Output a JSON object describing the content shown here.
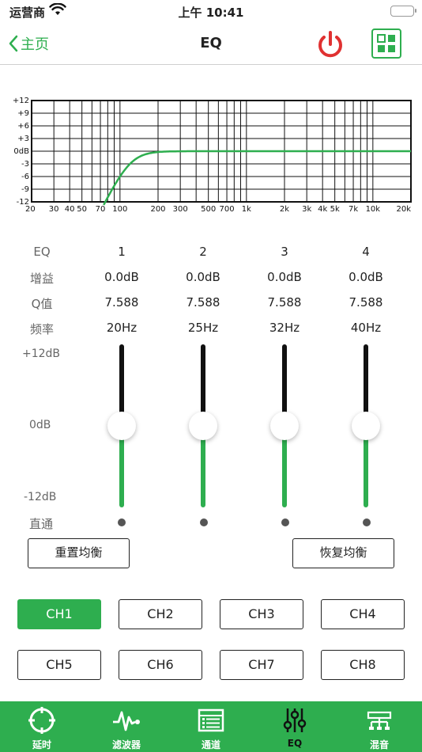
{
  "status": {
    "carrier": "运营商",
    "time": "上午 10:41"
  },
  "nav": {
    "back_label": "主页",
    "title": "EQ"
  },
  "graph": {
    "y_ticks": [
      "+12",
      "+9",
      "+6",
      "+3",
      "0dB",
      "-3",
      "-6",
      "-9",
      "-12"
    ],
    "x_ticks": [
      "20",
      "30",
      "40",
      "50",
      "70",
      "100",
      "200",
      "300",
      "500",
      "700",
      "1k",
      "2k",
      "3k",
      "4k",
      "5k",
      "7k",
      "10k",
      "20k"
    ],
    "curve_color": "#2eae4f"
  },
  "table": {
    "header_label": "EQ",
    "gain_label": "增益",
    "q_label": "Q值",
    "freq_label": "频率",
    "bands": [
      {
        "num": "1",
        "gain": "0.0dB",
        "q": "7.588",
        "freq": "20Hz",
        "level": 0.5
      },
      {
        "num": "2",
        "gain": "0.0dB",
        "q": "7.588",
        "freq": "25Hz",
        "level": 0.5
      },
      {
        "num": "3",
        "gain": "0.0dB",
        "q": "7.588",
        "freq": "32Hz",
        "level": 0.5
      },
      {
        "num": "4",
        "gain": "0.0dB",
        "q": "7.588",
        "freq": "40Hz",
        "level": 0.5
      }
    ]
  },
  "sliders": {
    "max_label": "+12dB",
    "mid_label": "0dB",
    "min_label": "-12dB",
    "bypass_label": "直通"
  },
  "buttons": {
    "reset": "重置均衡",
    "restore": "恢复均衡"
  },
  "channels": [
    "CH1",
    "CH2",
    "CH3",
    "CH4",
    "CH5",
    "CH6",
    "CH7",
    "CH8"
  ],
  "active_channel": "CH1",
  "tabs": [
    {
      "label": "延时",
      "icon": "delay-icon"
    },
    {
      "label": "滤波器",
      "icon": "waveform-icon"
    },
    {
      "label": "通道",
      "icon": "channel-list-icon"
    },
    {
      "label": "EQ",
      "icon": "eq-sliders-icon"
    },
    {
      "label": "混音",
      "icon": "mixer-icon"
    }
  ],
  "colors": {
    "accent": "#2eae4f",
    "power": "#e03131"
  }
}
